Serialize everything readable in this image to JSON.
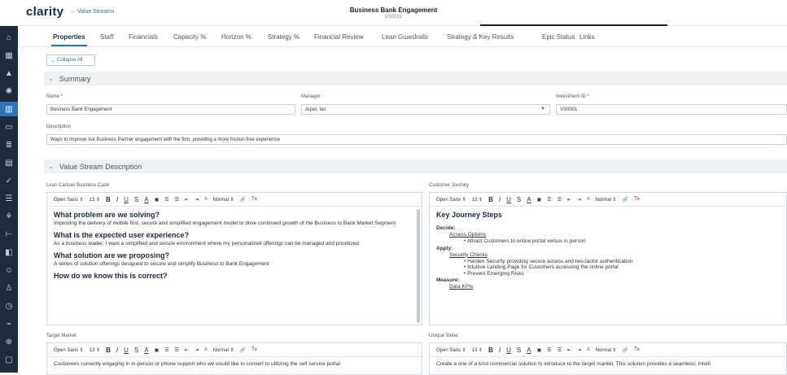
{
  "header": {
    "logo": "clarity",
    "back_label": "← Value Streams",
    "title": "Business Bank Engagement",
    "subtitle": "VS0001"
  },
  "rail": {
    "items": [
      {
        "icon": "home-icon",
        "glyph": "⌂"
      },
      {
        "icon": "grid-icon",
        "glyph": "▦"
      },
      {
        "icon": "mountain-icon",
        "glyph": "▲"
      },
      {
        "icon": "sun-icon",
        "glyph": "✺"
      },
      {
        "icon": "bar-chart-icon",
        "glyph": "▥",
        "active": true
      },
      {
        "icon": "monitor-icon",
        "glyph": "▭"
      },
      {
        "icon": "database-icon",
        "glyph": "≣"
      },
      {
        "icon": "document-icon",
        "glyph": "▤"
      },
      {
        "icon": "check-icon",
        "glyph": "✓"
      },
      {
        "icon": "list-check-icon",
        "glyph": "☰"
      },
      {
        "icon": "org-chart-icon",
        "glyph": "⚘"
      },
      {
        "icon": "hierarchy-icon",
        "glyph": "⊢"
      },
      {
        "icon": "portfolio-icon",
        "glyph": "◧"
      },
      {
        "icon": "people-icon",
        "glyph": "☺"
      },
      {
        "icon": "person-settings-icon",
        "glyph": "♙"
      },
      {
        "icon": "clock-icon",
        "glyph": "◷"
      },
      {
        "icon": "link-icon",
        "glyph": "⌁"
      },
      {
        "icon": "globe-icon",
        "glyph": "⊕"
      },
      {
        "icon": "message-icon",
        "glyph": "▢"
      }
    ]
  },
  "tabs": [
    {
      "label": "Properties",
      "active": true
    },
    {
      "label": "Staff"
    },
    {
      "label": "Financials"
    },
    {
      "label": "Capacity %"
    },
    {
      "label": "Horizon %"
    },
    {
      "label": "Strategy %"
    },
    {
      "label": "Financial Review"
    },
    {
      "label": "Lean Guardrails"
    },
    {
      "label": "Strategy & Key Results"
    },
    {
      "label": "Epic Status"
    },
    {
      "label": "Links"
    }
  ],
  "collapse_label": "Collapse All",
  "summary": {
    "header": "Summary",
    "name_label": "Name *",
    "name_value": "Business Bank Engagement",
    "manager_label": "Manager",
    "manager_value": "Arpel, Ian",
    "investment_label": "Investment ID *",
    "investment_value": "VS0001",
    "description_label": "Description",
    "description_value": "Ways to improve our Business Partner engagement with the firm, providing a more friction-free experience"
  },
  "vsd": {
    "header": "Value Stream Description",
    "toolbar": {
      "font": "Open Sans ⇕",
      "size": "13 ⇕",
      "bold": "B",
      "italic": "I",
      "underline": "U",
      "strike": "S",
      "color": "A",
      "highlight": "▣",
      "ol": "☰",
      "ul": "☰",
      "outdent": "⇤",
      "indent": "⇥",
      "align": "≡",
      "style": "Normal ⇕",
      "link": "🔗",
      "clear": "Tx"
    },
    "lean": {
      "label": "Lean Canvas Business Case",
      "h1": "What problem are we solving?",
      "p1": "Improving the delivery of mobile first, secure and simplified engagement model to drive continued growth of the Business to Bank Market Segment",
      "h2": "What is the expected user experience?",
      "p2": "As a business leader, I want a simplified and secure environment where my personalized offerings can be managed and prioritized.",
      "h3": "What solution are we proposing?",
      "p3": "A series of solution offerings designed to secure and simplify Business to Bank Engagement",
      "h4": "How do we know this is correct?"
    },
    "journey": {
      "label": "Customer Journey",
      "h1": "Key Journey Steps",
      "decide": "Decide:",
      "access": "Access Options",
      "access_li": "• Attract Customers to online portal versus in person",
      "apply": "Apply:",
      "security": "Security Checks",
      "sec_li1": "• Harden Security providing secure access and two-factor authentication",
      "sec_li2": "• Intuitive Landing Page for Customers accessing the online portal",
      "sec_li3": "• Prevent Emerging Risks",
      "measure": "Measure:",
      "kpis": "Data KPIs"
    },
    "target": {
      "label": "Target Market",
      "text": "Customers currently engaging in in-person or phone support who we would like to convert to utilizing the self service portal"
    },
    "unique": {
      "label": "Unique Value",
      "text": "Create a one of a kind commercial solution to introduce to the target market. This solution provides a seamless, intuiti"
    }
  }
}
